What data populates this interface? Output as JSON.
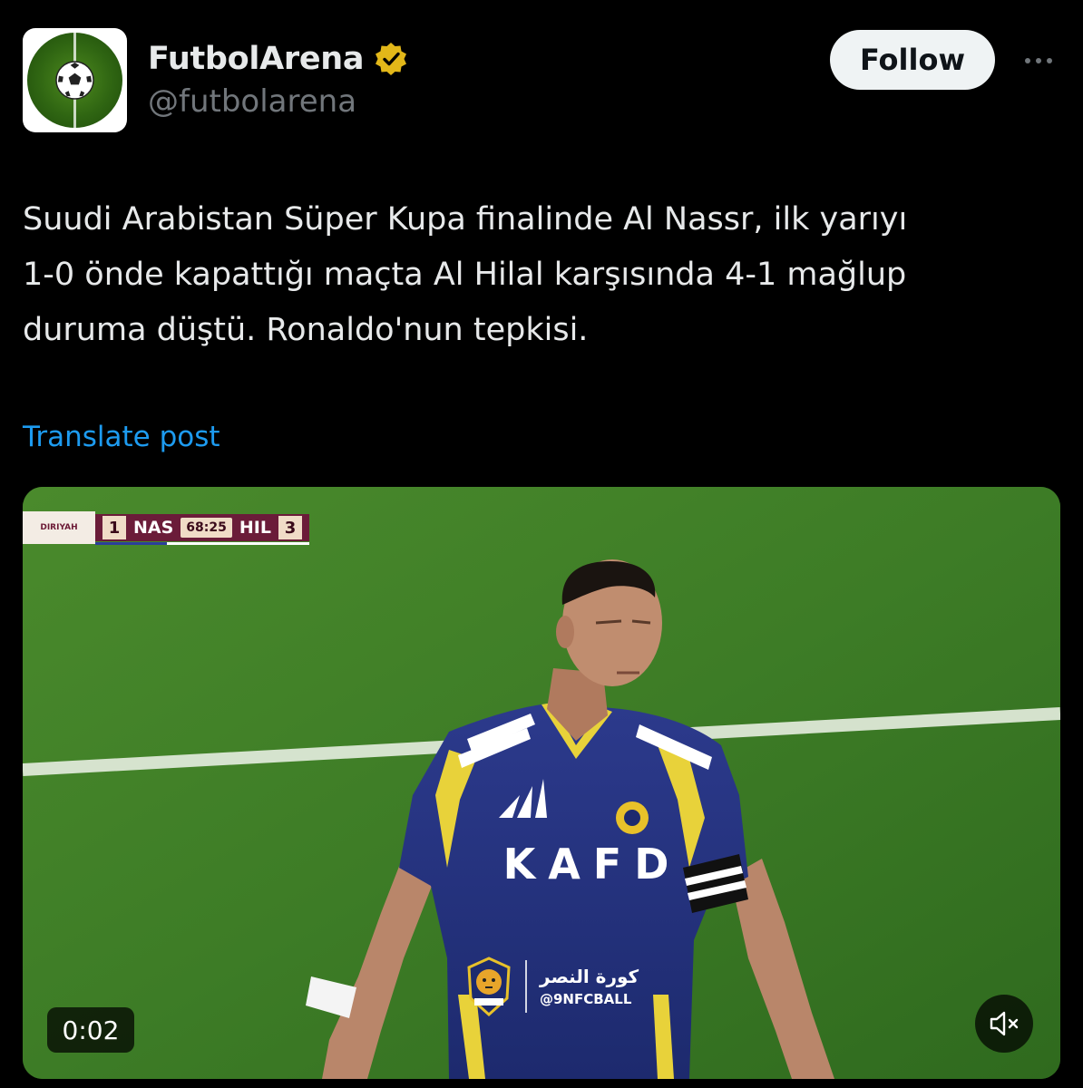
{
  "author": {
    "display_name": "FutbolArena",
    "handle": "@futbolarena",
    "avatar_icon": "soccer-ball-icon",
    "verified_icon": "verified-badge-icon"
  },
  "header": {
    "follow_label": "Follow",
    "more_icon": "more-options-icon"
  },
  "post": {
    "text_lines": [
      "Suudi Arabistan Süper Kupa finalinde Al Nassr, ilk yarıyı",
      "1-0 önde kapattığı maçta Al Hilal karşısında 4-1 mağlup",
      "duruma düştü. Ronaldo'nun tepkisi."
    ],
    "translate_label": "Translate post"
  },
  "media": {
    "scoreboard": {
      "logo_text": "DIRIYAH",
      "home_score": "1",
      "home_team": "NAS",
      "clock": "68:25",
      "away_team": "HIL",
      "away_score": "3"
    },
    "jersey": {
      "sponsor": "KAFD"
    },
    "watermark": {
      "arabic": "كورة النصر",
      "handle": "@9NFCBALL"
    },
    "timer": "0:02",
    "mute_icon": "muted-speaker-icon"
  },
  "colors": {
    "background": "#000000",
    "text_primary": "#e7e9ea",
    "text_secondary": "#71767b",
    "link": "#1d9bf0",
    "follow_bg": "#eff3f4",
    "verified_gold": "#e2b719",
    "scoreboard_maroon": "#6b1c39"
  }
}
